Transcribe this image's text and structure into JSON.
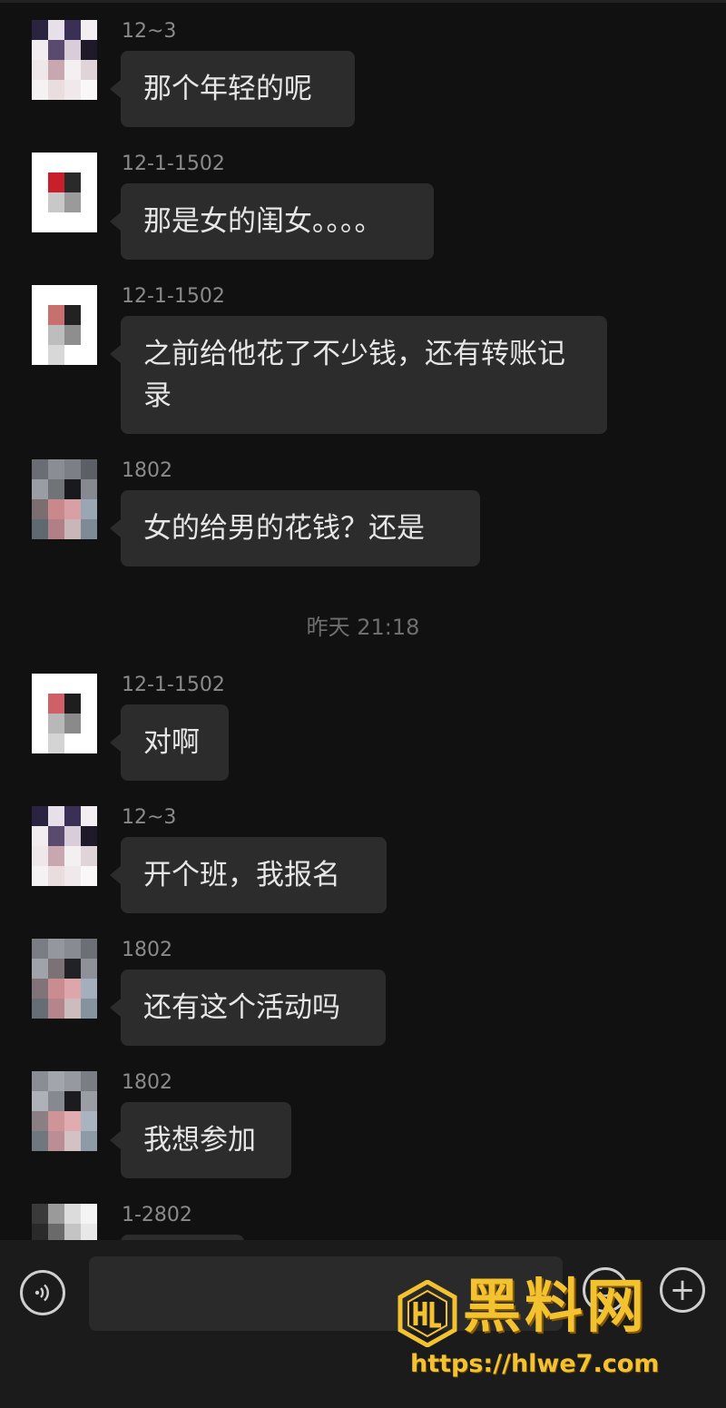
{
  "messages": [
    {
      "sender": "12~3",
      "text": "那个年轻的呢"
    },
    {
      "sender": "12-1-1502",
      "text": "那是女的闺女。。。。"
    },
    {
      "sender": "12-1-1502",
      "text": "之前给他花了不少钱，还有转账记录"
    },
    {
      "sender": "1802",
      "text": "女的给男的花钱？还是"
    },
    {
      "sender": "12-1-1502",
      "text": "对啊"
    },
    {
      "sender": "12~3",
      "text": "开个班，我报名"
    },
    {
      "sender": "1802",
      "text": "还有这个活动吗"
    },
    {
      "sender": "1802",
      "text": "我想参加"
    },
    {
      "sender": "1-2802",
      "text": ""
    }
  ],
  "timestamp": "昨天 21:18",
  "input_bar": {
    "voice_icon": "voice-icon",
    "emoji_icon": "emoji-icon",
    "plus_icon": "plus-icon",
    "plus_symbol": "+"
  },
  "watermark": {
    "logo_letters": "HL",
    "title": "黑料网",
    "url": "https://hlwe7.com"
  },
  "colors": {
    "background": "#111111",
    "bubble": "#2c2c2c",
    "text": "#e6e6e6",
    "sender": "#8a8a8a",
    "watermark": "#f2c230"
  }
}
